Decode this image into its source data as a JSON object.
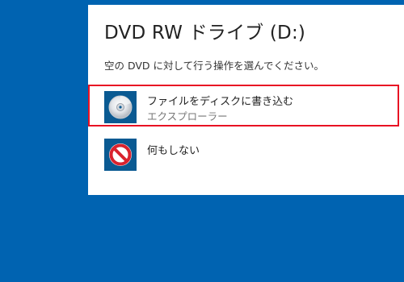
{
  "dialog": {
    "title": "DVD RW ドライブ (D:)",
    "prompt": "空の DVD に対して行う操作を選んでください。"
  },
  "options": [
    {
      "label": "ファイルをディスクに書き込む",
      "sub": "エクスプローラー",
      "icon": "disc-icon",
      "selected": true
    },
    {
      "label": "何もしない",
      "icon": "prohibited-icon",
      "selected": false
    }
  ],
  "colors": {
    "desktop": "#0063B1",
    "icon_background": "#0A5A92",
    "selection_border": "#E81123",
    "prohibit_red": "#D9232E"
  }
}
